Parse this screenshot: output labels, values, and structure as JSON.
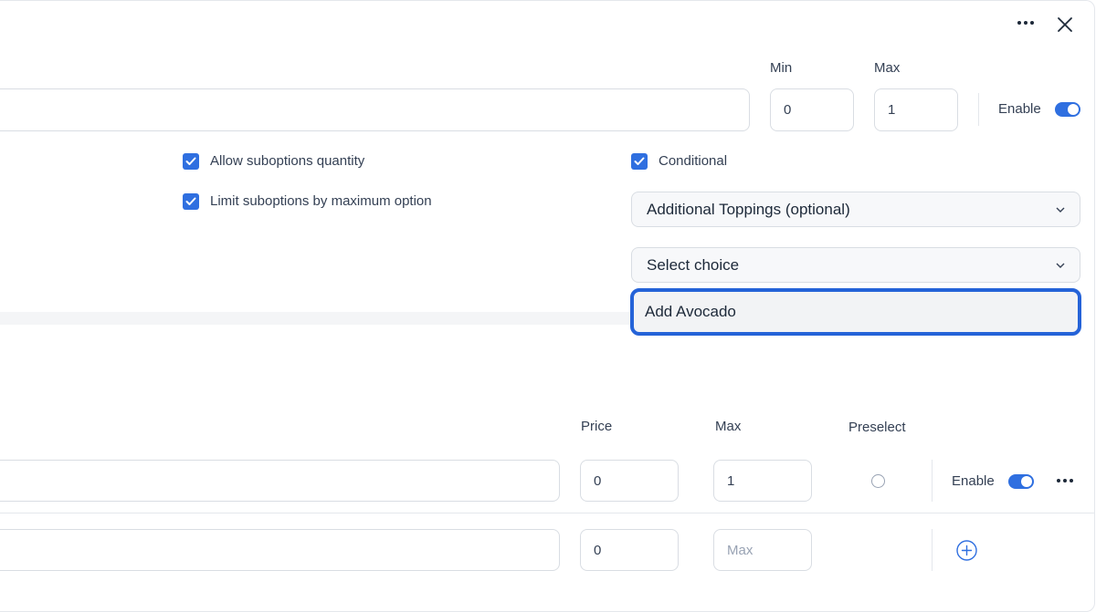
{
  "header": {
    "more_icon": "more-horizontal-icon",
    "close_icon": "close-icon"
  },
  "option": {
    "min_label": "Min",
    "max_label": "Max",
    "min_value": "0",
    "max_value": "1",
    "enable_label": "Enable",
    "enabled": true
  },
  "settings": {
    "allow_quantity_label": "Allow suboptions quantity",
    "limit_by_max_label": "Limit suboptions by maximum option",
    "conditional_label": "Conditional",
    "conditional_option": "Additional Toppings (optional)",
    "choice_placeholder": "Select choice",
    "choice_dropdown_item": "Add Avocado"
  },
  "suboptions": {
    "price_label": "Price",
    "max_label": "Max",
    "preselect_label": "Preselect",
    "rows": [
      {
        "price": "0",
        "max": "1",
        "enable_label": "Enable",
        "enabled": true
      },
      {
        "price": "0",
        "max_placeholder": "Max"
      }
    ]
  },
  "colors": {
    "accent": "#2f6fe0",
    "focus_border": "#2563d8"
  }
}
